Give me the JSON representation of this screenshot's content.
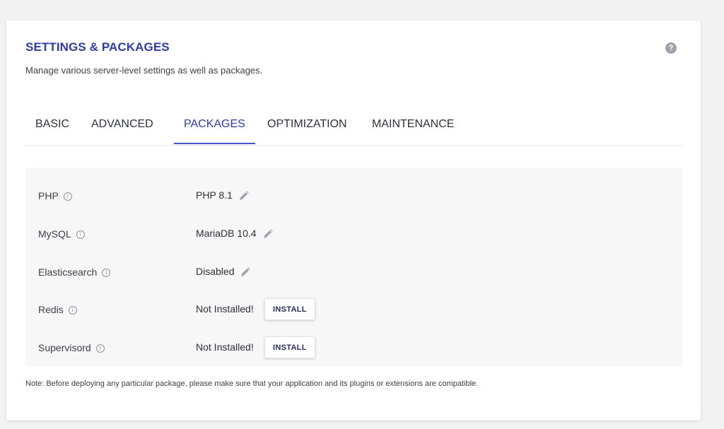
{
  "header": {
    "title": "SETTINGS & PACKAGES",
    "subtitle": "Manage various server-level settings as well as packages.",
    "help_icon": "?"
  },
  "tabs": [
    {
      "label": "BASIC",
      "active": false
    },
    {
      "label": "ADVANCED",
      "active": false
    },
    {
      "label": "PACKAGES",
      "active": true
    },
    {
      "label": "OPTIMIZATION",
      "active": false
    },
    {
      "label": "MAINTENANCE",
      "active": false
    }
  ],
  "packages": [
    {
      "label": "PHP",
      "value": "PHP 8.1",
      "action": "edit"
    },
    {
      "label": "MySQL",
      "value": "MariaDB 10.4",
      "action": "edit"
    },
    {
      "label": "Elasticsearch",
      "value": "Disabled",
      "action": "edit"
    },
    {
      "label": "Redis",
      "value": "Not Installed!",
      "action": "install",
      "button_label": "INSTALL"
    },
    {
      "label": "Supervisord",
      "value": "Not Installed!",
      "action": "install",
      "button_label": "INSTALL"
    }
  ],
  "info_glyph": "i",
  "note": "Note: Before deploying any particular package, please make sure that your application and its plugins or extensions are compatible.",
  "colors": {
    "accent": "#2f3ba8",
    "tab_underline": "#4755c9",
    "panel_bg": "#f7f7f8",
    "icon_gray": "#9da2ad"
  },
  "icons": {
    "help": "help-icon",
    "info": "info-icon",
    "edit": "pencil-icon"
  }
}
